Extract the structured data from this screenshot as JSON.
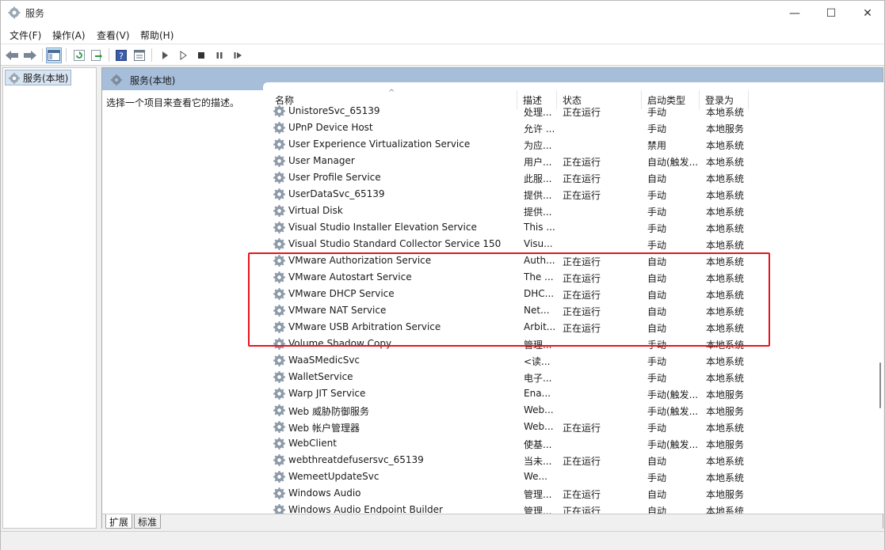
{
  "window": {
    "title": "服务",
    "min_glyph": "—",
    "max_glyph": "☐",
    "close_glyph": "✕"
  },
  "menu": {
    "file": "文件(F)",
    "action": "操作(A)",
    "view": "查看(V)",
    "help": "帮助(H)"
  },
  "tree": {
    "root_label": "服务(本地)"
  },
  "pane": {
    "header": "服务(本地)",
    "description_hint": "选择一个项目来查看它的描述。"
  },
  "columns": {
    "name": "名称",
    "description": "描述",
    "status": "状态",
    "startup_type": "启动类型",
    "log_on_as": "登录为"
  },
  "services": [
    {
      "name": "UnistoreSvc_65139",
      "description": "处理...",
      "status": "正在运行",
      "startup": "手动",
      "logon": "本地系统"
    },
    {
      "name": "UPnP Device Host",
      "description": "允许 ...",
      "status": "",
      "startup": "手动",
      "logon": "本地服务"
    },
    {
      "name": "User Experience Virtualization Service",
      "description": "为应...",
      "status": "",
      "startup": "禁用",
      "logon": "本地系统"
    },
    {
      "name": "User Manager",
      "description": "用户...",
      "status": "正在运行",
      "startup": "自动(触发...",
      "logon": "本地系统"
    },
    {
      "name": "User Profile Service",
      "description": "此服...",
      "status": "正在运行",
      "startup": "自动",
      "logon": "本地系统"
    },
    {
      "name": "UserDataSvc_65139",
      "description": "提供...",
      "status": "正在运行",
      "startup": "手动",
      "logon": "本地系统"
    },
    {
      "name": "Virtual Disk",
      "description": "提供...",
      "status": "",
      "startup": "手动",
      "logon": "本地系统"
    },
    {
      "name": "Visual Studio Installer Elevation Service",
      "description": "This ...",
      "status": "",
      "startup": "手动",
      "logon": "本地系统"
    },
    {
      "name": "Visual Studio Standard Collector Service 150",
      "description": "Visu...",
      "status": "",
      "startup": "手动",
      "logon": "本地系统"
    },
    {
      "name": "VMware Authorization Service",
      "description": "Auth...",
      "status": "正在运行",
      "startup": "自动",
      "logon": "本地系统"
    },
    {
      "name": "VMware Autostart Service",
      "description": "The ...",
      "status": "正在运行",
      "startup": "自动",
      "logon": "本地系统"
    },
    {
      "name": "VMware DHCP Service",
      "description": "DHC...",
      "status": "正在运行",
      "startup": "自动",
      "logon": "本地系统"
    },
    {
      "name": "VMware NAT Service",
      "description": "Net...",
      "status": "正在运行",
      "startup": "自动",
      "logon": "本地系统"
    },
    {
      "name": "VMware USB Arbitration Service",
      "description": "Arbit...",
      "status": "正在运行",
      "startup": "自动",
      "logon": "本地系统"
    },
    {
      "name": "Volume Shadow Copy",
      "description": "管理...",
      "status": "",
      "startup": "手动",
      "logon": "本地系统"
    },
    {
      "name": "WaaSMedicSvc",
      "description": "<读...",
      "status": "",
      "startup": "手动",
      "logon": "本地系统"
    },
    {
      "name": "WalletService",
      "description": "电子...",
      "status": "",
      "startup": "手动",
      "logon": "本地系统"
    },
    {
      "name": "Warp JIT Service",
      "description": "Ena...",
      "status": "",
      "startup": "手动(触发...",
      "logon": "本地服务"
    },
    {
      "name": "Web 威胁防御服务",
      "description": "Web...",
      "status": "",
      "startup": "手动(触发...",
      "logon": "本地服务"
    },
    {
      "name": "Web 帐户管理器",
      "description": "Web...",
      "status": "正在运行",
      "startup": "手动",
      "logon": "本地系统"
    },
    {
      "name": "WebClient",
      "description": "使基...",
      "status": "",
      "startup": "手动(触发...",
      "logon": "本地服务"
    },
    {
      "name": "webthreatdefusersvc_65139",
      "description": "当未...",
      "status": "正在运行",
      "startup": "自动",
      "logon": "本地系统"
    },
    {
      "name": "WemeetUpdateSvc",
      "description": "We...",
      "status": "",
      "startup": "手动",
      "logon": "本地系统"
    },
    {
      "name": "Windows Audio",
      "description": "管理...",
      "status": "正在运行",
      "startup": "自动",
      "logon": "本地服务"
    },
    {
      "name": "Windows Audio Endpoint Builder",
      "description": "管理...",
      "status": "正在运行",
      "startup": "自动",
      "logon": "本地系统"
    }
  ],
  "tabs": {
    "extended": "扩展",
    "standard": "标准"
  },
  "colors": {
    "highlight": "#e8141d",
    "pane_header": "#a6bed9"
  }
}
